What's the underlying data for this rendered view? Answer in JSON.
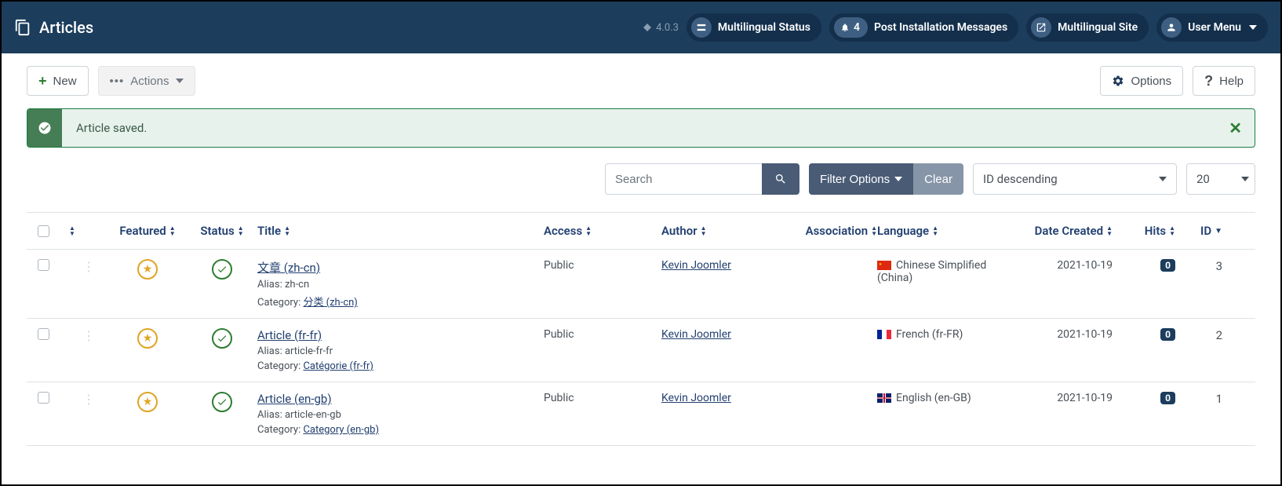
{
  "header": {
    "title": "Articles",
    "version": "4.0.3",
    "multilingual_status": "Multilingual Status",
    "notifications_count": "4",
    "post_install": "Post Installation Messages",
    "multilingual_site": "Multilingual Site",
    "user_menu": "User Menu"
  },
  "toolbar": {
    "new_label": "New",
    "actions_label": "Actions",
    "options_label": "Options",
    "help_label": "Help"
  },
  "alert": {
    "message": "Article saved."
  },
  "filters": {
    "search_placeholder": "Search",
    "filter_options": "Filter Options",
    "clear": "Clear",
    "sort": "ID descending",
    "limit": "20"
  },
  "columns": {
    "featured": "Featured",
    "status": "Status",
    "title": "Title",
    "access": "Access",
    "author": "Author",
    "association": "Association",
    "language": "Language",
    "date_created": "Date Created",
    "hits": "Hits",
    "id": "ID"
  },
  "meta": {
    "alias_label": "Alias:",
    "category_label": "Category:"
  },
  "rows": [
    {
      "title": "文章 (zh-cn)",
      "alias": "zh-cn",
      "category": "分类 (zh-cn)",
      "access": "Public",
      "author": "Kevin Joomler",
      "flag": "cn",
      "language": "Chinese Simplified (China)",
      "date": "2021-10-19",
      "hits": "0",
      "id": "3"
    },
    {
      "title": "Article (fr-fr)",
      "alias": "article-fr-fr",
      "category": "Catégorie (fr-fr)",
      "access": "Public",
      "author": "Kevin Joomler",
      "flag": "fr",
      "language": "French (fr-FR)",
      "date": "2021-10-19",
      "hits": "0",
      "id": "2"
    },
    {
      "title": "Article (en-gb)",
      "alias": "article-en-gb",
      "category": "Category (en-gb)",
      "access": "Public",
      "author": "Kevin Joomler",
      "flag": "gb",
      "language": "English (en-GB)",
      "date": "2021-10-19",
      "hits": "0",
      "id": "1"
    }
  ]
}
